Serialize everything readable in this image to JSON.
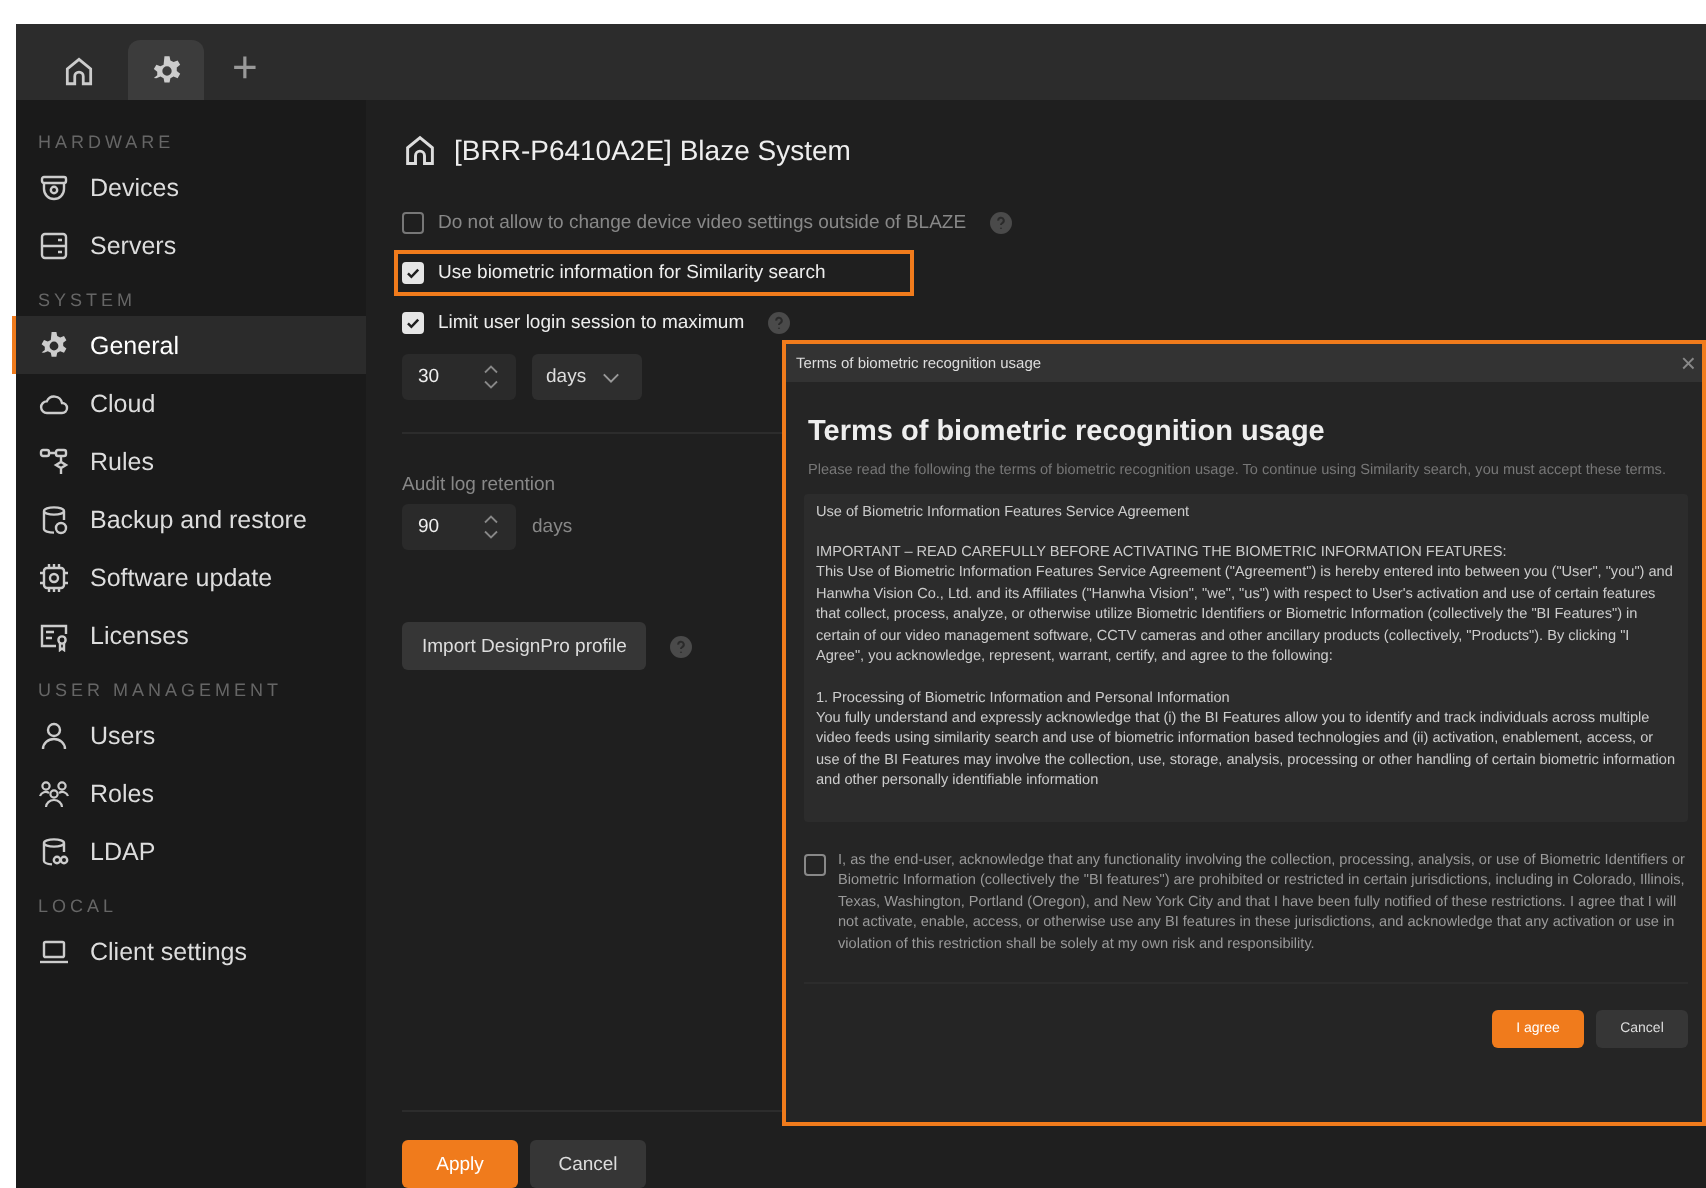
{
  "tabs": [
    {
      "selected": false
    },
    {
      "selected": true
    }
  ],
  "add_tab": "+",
  "sidebar": {
    "sections": [
      {
        "title": "HARDWARE",
        "items": [
          {
            "label": "Devices",
            "selected": false
          },
          {
            "label": "Servers",
            "selected": false
          }
        ]
      },
      {
        "title": "SYSTEM",
        "items": [
          {
            "label": "General",
            "selected": true
          },
          {
            "label": "Cloud",
            "selected": false
          },
          {
            "label": "Rules",
            "selected": false
          },
          {
            "label": "Backup and restore",
            "selected": false
          },
          {
            "label": "Software update",
            "selected": false
          },
          {
            "label": "Licenses",
            "selected": false
          }
        ]
      },
      {
        "title": "USER MANAGEMENT",
        "items": [
          {
            "label": "Users",
            "selected": false
          },
          {
            "label": "Roles",
            "selected": false
          },
          {
            "label": "LDAP",
            "selected": false
          }
        ]
      },
      {
        "title": "LOCAL",
        "items": [
          {
            "label": "Client settings",
            "selected": false
          }
        ]
      }
    ]
  },
  "page_title": "[BRR-P6410A2E] Blaze System",
  "options": [
    {
      "label": "Do not allow to change device video settings outside of BLAZE",
      "checked": false,
      "disabled": true,
      "help": true,
      "highlighted": false
    },
    {
      "label": "Use biometric information for Similarity search",
      "checked": true,
      "disabled": false,
      "help": false,
      "highlighted": true
    },
    {
      "label": "Limit user login session to maximum",
      "checked": true,
      "disabled": false,
      "help": true,
      "highlighted": false
    }
  ],
  "session_limit": {
    "value": "30",
    "unit": "days"
  },
  "audit_log": {
    "label": "Audit log retention",
    "value": "90",
    "unit": "days"
  },
  "import_button": "Import DesignPro profile",
  "footer_buttons": [
    "Apply",
    "Cancel"
  ],
  "dialog": {
    "window_title": "Terms of biometric recognition usage",
    "close": "×",
    "highlighted": true,
    "heading": "Terms of biometric recognition usage",
    "description": "Please read the following the terms of biometric recognition usage. To continue using Similarity search, you must accept these terms.",
    "agreement": [
      [
        "Use of Biometric Information Features Service Agreement"
      ],
      [
        "IMPORTANT – READ CAREFULLY BEFORE ACTIVATING THE BIOMETRIC INFORMATION FEATURES:",
        "This Use of Biometric Information Features Service Agreement (\"Agreement\") is hereby entered into between you (\"User\", \"you\") and Hanwha Vision Co., Ltd. and its Affiliates (\"Hanwha Vision\", \"we\", \"us\") with respect to User's activation and use of certain features that collect, process, analyze, or otherwise utilize Biometric Identifiers or Biometric Information (collectively the \"BI Features\") in certain of our video management software, CCTV cameras and other ancillary products (collectively, \"Products\"). By clicking \"I Agree\", you acknowledge, represent, warrant, certify, and agree to the following:"
      ],
      [
        "1. Processing of Biometric Information and Personal Information",
        "You fully understand and expressly acknowledge that (i) the BI Features allow you to identify and track individuals across multiple video feeds using similarity search and use of biometric information based technologies and (ii) activation, enablement, access, or use of the BI Features may involve the collection, use, storage, analysis, processing or other handling of certain biometric information and other personally identifiable information"
      ]
    ],
    "consent": {
      "label": "I, as the end-user, acknowledge that any functionality involving the collection, processing, analysis, or use of Biometric Identifiers or Biometric Information (collectively the \"BI features\") are prohibited or restricted in certain jurisdictions, including in Colorado, Illinois, Texas, Washington, Portland (Oregon), and New York City and that I have been fully notified of these restrictions. I agree that I will not activate, enable, access, or otherwise use any BI features in these jurisdictions, and acknowledge that any activation or use in violation of this restriction shall be solely at my own risk and responsibility.",
      "checked": false
    },
    "buttons": [
      "I agree",
      "Cancel"
    ]
  }
}
